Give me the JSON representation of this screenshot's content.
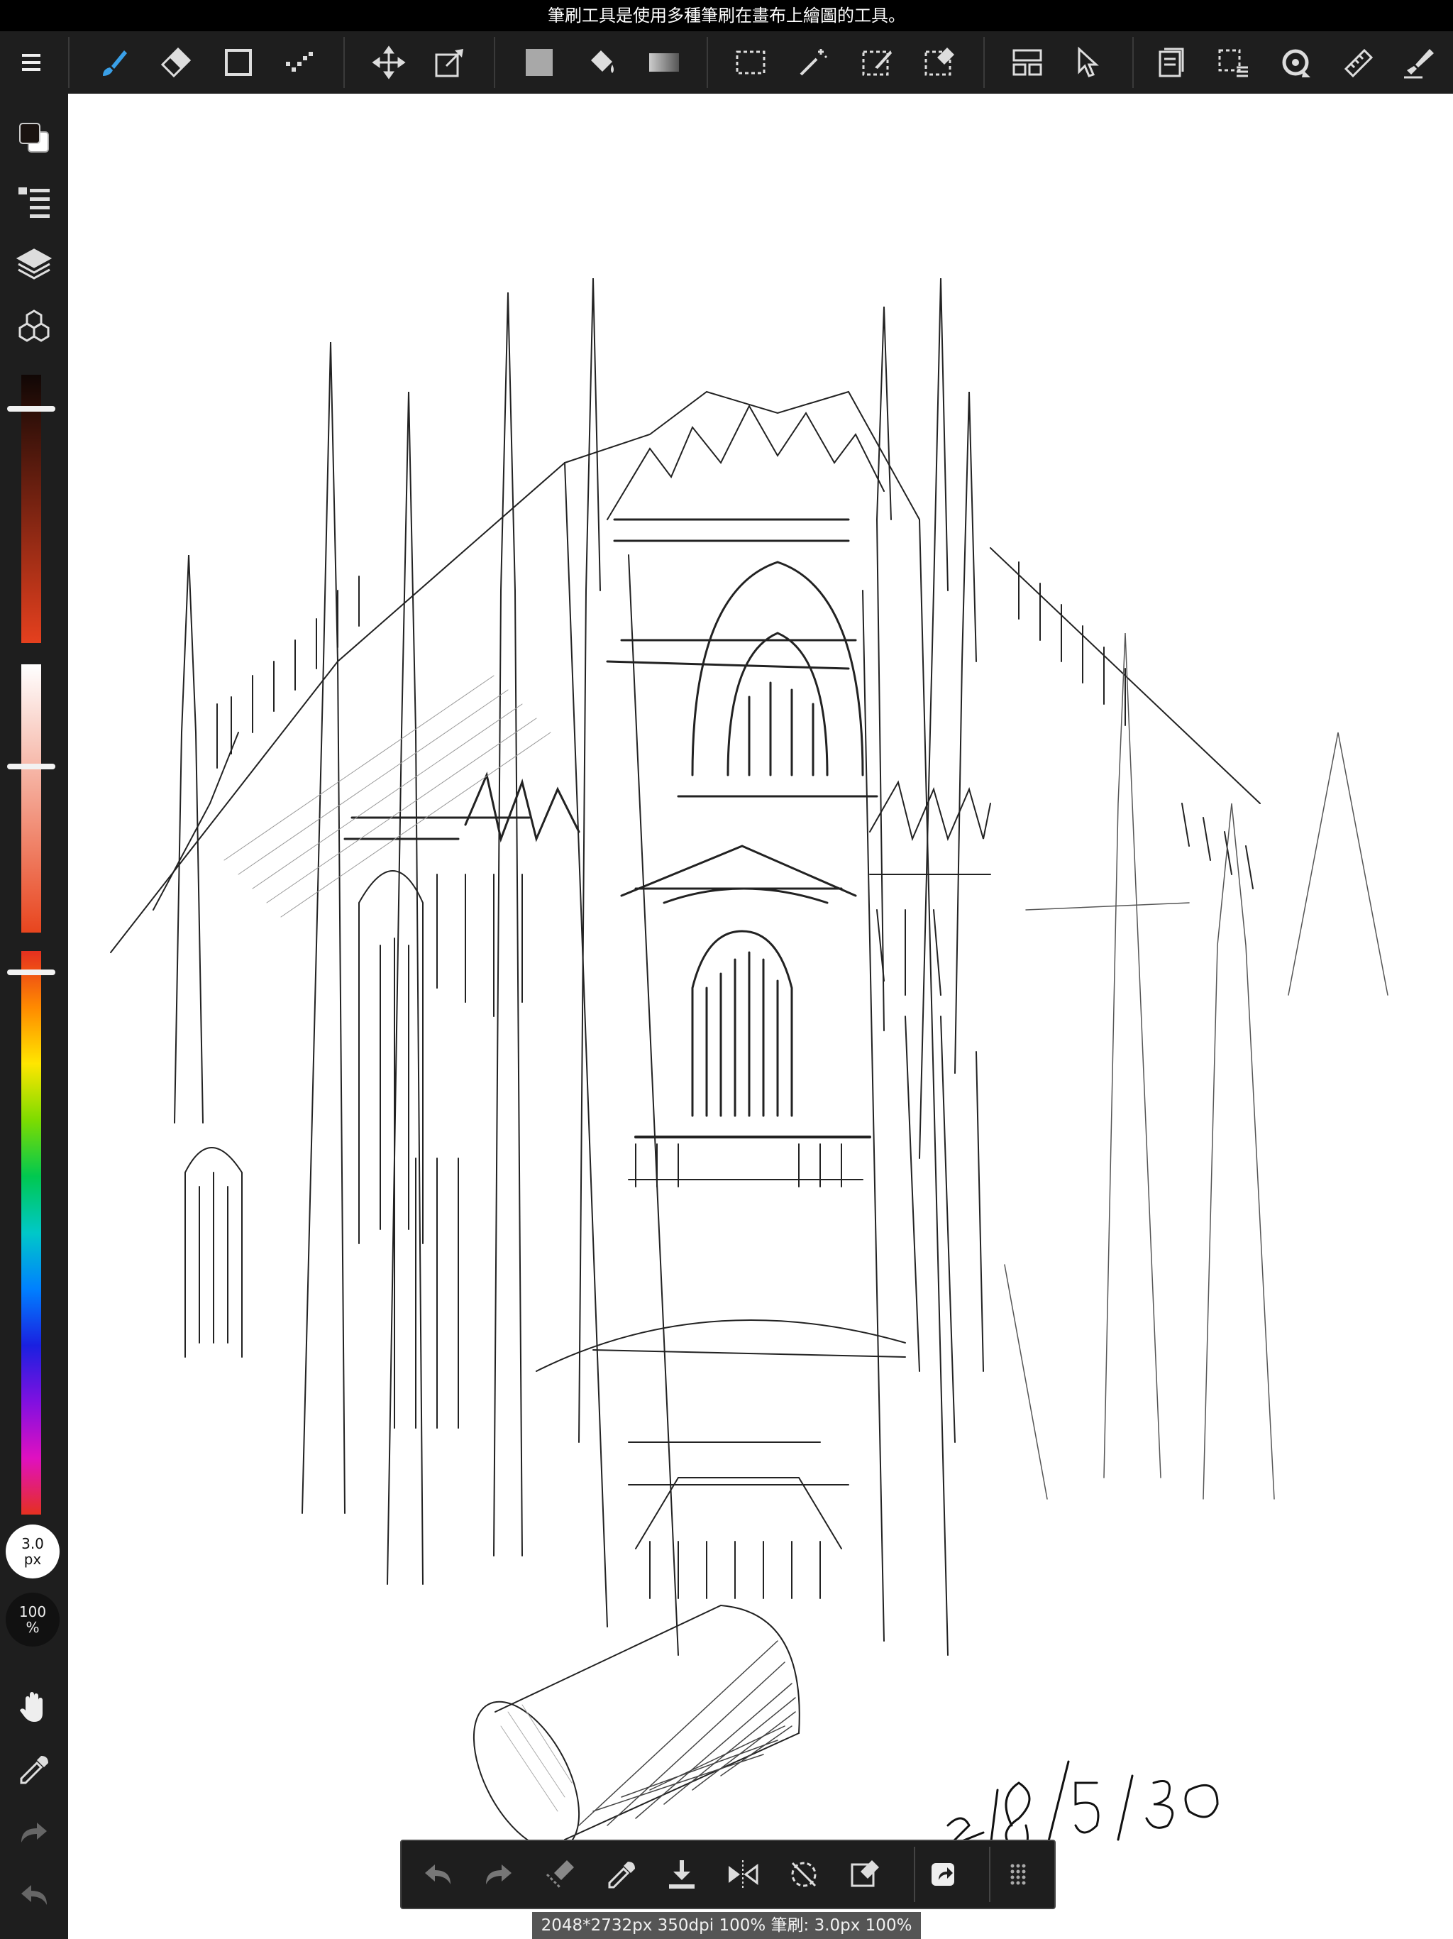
{
  "tooltip": {
    "text": "筆刷工具是使用多種筆刷在畫布上繪圖的工具。"
  },
  "toolbar": {
    "tools": [
      {
        "name": "menu-icon"
      },
      {
        "name": "brush-tool-icon"
      },
      {
        "name": "eraser-tool-icon"
      },
      {
        "name": "shape-tool-icon"
      },
      {
        "name": "dot-tool-icon"
      },
      {
        "name": "move-tool-icon"
      },
      {
        "name": "transform-tool-icon"
      },
      {
        "name": "fill-color-icon"
      },
      {
        "name": "bucket-tool-icon"
      },
      {
        "name": "gradient-tool-icon"
      },
      {
        "name": "select-tool-icon"
      },
      {
        "name": "magic-wand-icon"
      },
      {
        "name": "select-pen-icon"
      },
      {
        "name": "select-eraser-icon"
      },
      {
        "name": "frame-divider-icon"
      },
      {
        "name": "operation-tool-icon"
      },
      {
        "name": "material-icon"
      },
      {
        "name": "snap-select-icon"
      },
      {
        "name": "rotate-canvas-icon"
      },
      {
        "name": "ruler-icon"
      },
      {
        "name": "text-brush-icon"
      }
    ],
    "accent": "#3aa0e8"
  },
  "sidebar": {
    "brush_size": {
      "value": "3.0",
      "unit": "px"
    },
    "opacity": {
      "value": "100",
      "unit": "%"
    },
    "colors": {
      "foreground": "#1a1310",
      "background": "#ffffff",
      "slider_brightness_top": "#100705",
      "slider_brightness_bottom": "#e5401e",
      "slider_saturation_top": "#ffffff",
      "slider_saturation_bottom": "#e8451e"
    }
  },
  "drawing": {
    "signature": "2018/5/30"
  },
  "status": {
    "text": "2048*2732px 350dpi 100% 筆刷: 3.0px 100%"
  }
}
